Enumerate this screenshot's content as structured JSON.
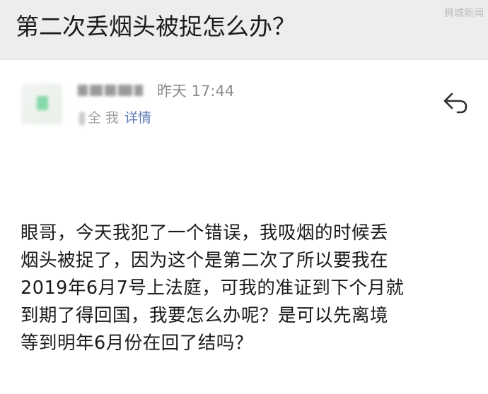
{
  "header": {
    "title": "第二次丢烟头被捉怎么办？",
    "watermark": "狮城新闻"
  },
  "email": {
    "time": "昨天 17:44",
    "to_prefix": "全 我",
    "details_label": "详情",
    "reply_icon": "reply-icon",
    "body_lines": [
      "眼哥，今天我犯了一个错误，我吸烟的时候丢",
      "烟头被捉了，因为这个是第二次了所以要我在",
      "2019年6月7号上法庭，可我的准证到下个月就",
      "到期了得回国，我要怎么办呢？是可以先离境",
      "等到明年6月份在回了结吗？"
    ]
  },
  "colors": {
    "title_bg": "#ededed",
    "link": "#5a7ab4",
    "meta": "#9e9e9e"
  }
}
